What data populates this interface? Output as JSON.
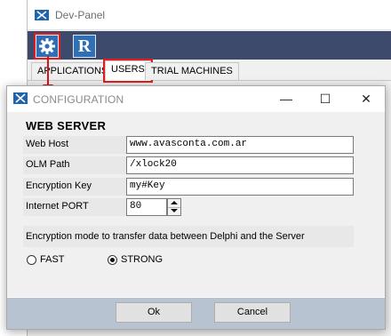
{
  "background_window": {
    "title": "Dev-Panel",
    "toolbar": {
      "settings_icon": "gear-icon",
      "r_button_label": "R"
    },
    "tabs": [
      {
        "label": "APPLICATIONS",
        "selected": false
      },
      {
        "label": "USERS",
        "selected": true
      },
      {
        "label": "TRIAL MACHINES",
        "selected": false
      }
    ]
  },
  "dialog": {
    "title": "CONFIGURATION",
    "window_controls": {
      "minimize": "—",
      "maximize": "☐",
      "close": "✕"
    },
    "section_title": "WEB SERVER",
    "fields": {
      "web_host": {
        "label": "Web Host",
        "value": "www.avasconta.com.ar"
      },
      "olm_path": {
        "label": "OLM Path",
        "value": "/xlock20"
      },
      "encryption_key": {
        "label": "Encryption Key",
        "value": "my#Key"
      },
      "internet_port": {
        "label": "Internet PORT",
        "value": "80"
      }
    },
    "encryption_info": "Encryption mode to transfer data between Delphi and the Server",
    "modes": {
      "fast": {
        "label": "FAST",
        "selected": false
      },
      "strong": {
        "label": "STRONG",
        "selected": true
      }
    },
    "buttons": {
      "ok": "Ok",
      "cancel": "Cancel"
    }
  },
  "colors": {
    "highlight_red": "#e01e1e",
    "toolbar_bg": "#3d4a6b",
    "icon_blue": "#2f6fb6",
    "footer_bg": "#b8c3d2"
  }
}
